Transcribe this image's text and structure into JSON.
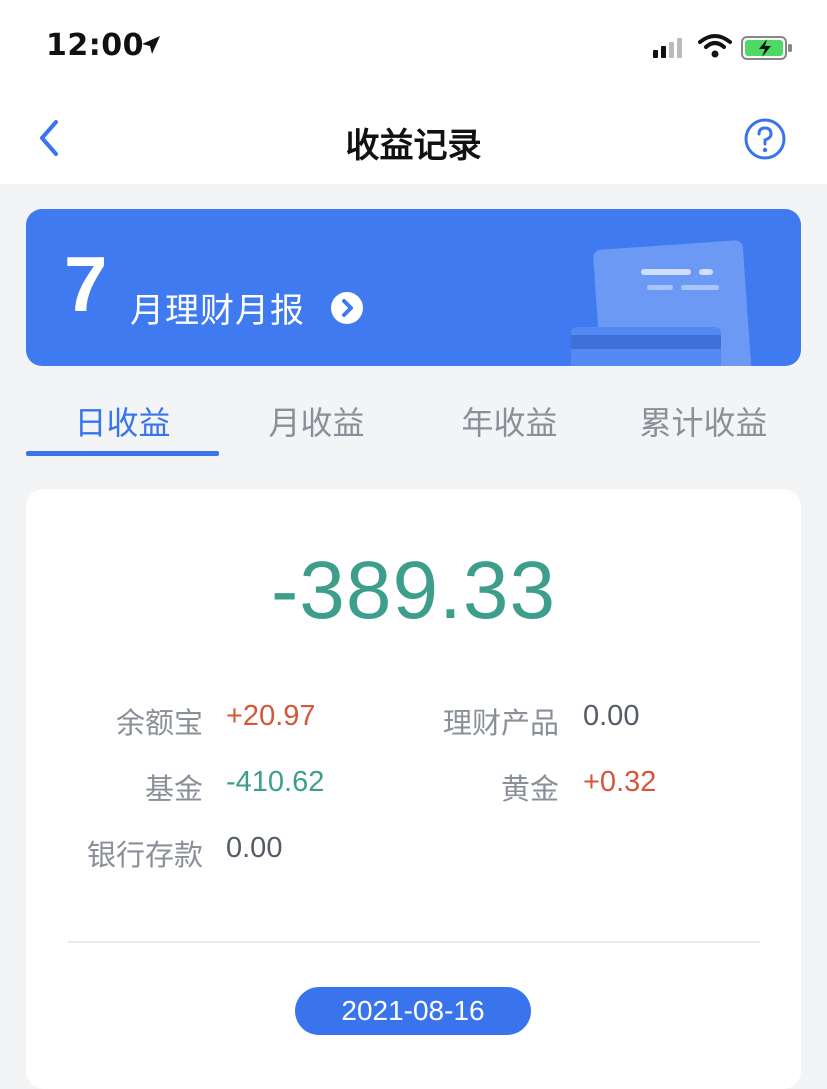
{
  "status_bar": {
    "time": "12:00"
  },
  "nav": {
    "title": "收益记录"
  },
  "banner": {
    "month": "7",
    "label": "月理财月报"
  },
  "tabs": [
    {
      "label": "日收益",
      "active": true
    },
    {
      "label": "月收益",
      "active": false
    },
    {
      "label": "年收益",
      "active": false
    },
    {
      "label": "累计收益",
      "active": false
    }
  ],
  "summary": {
    "total": "-389.33",
    "items": [
      {
        "label": "余额宝",
        "value": "+20.97",
        "trend": "positive"
      },
      {
        "label": "理财产品",
        "value": "0.00",
        "trend": "zero"
      },
      {
        "label": "基金",
        "value": "-410.62",
        "trend": "negative"
      },
      {
        "label": "黄金",
        "value": "+0.32",
        "trend": "positive"
      },
      {
        "label": "银行存款",
        "value": "0.00",
        "trend": "zero"
      }
    ]
  },
  "date_pill": "2021-08-16",
  "colors": {
    "accent": "#3a74ec",
    "banner": "#3f7af0",
    "positive": "#d6553b",
    "negative": "#3e9e8c",
    "muted": "#8a8f98"
  },
  "icons": {
    "back": "chevron-left-icon",
    "help": "question-circle-icon",
    "banner_arrow": "chevron-right-circle-icon"
  }
}
